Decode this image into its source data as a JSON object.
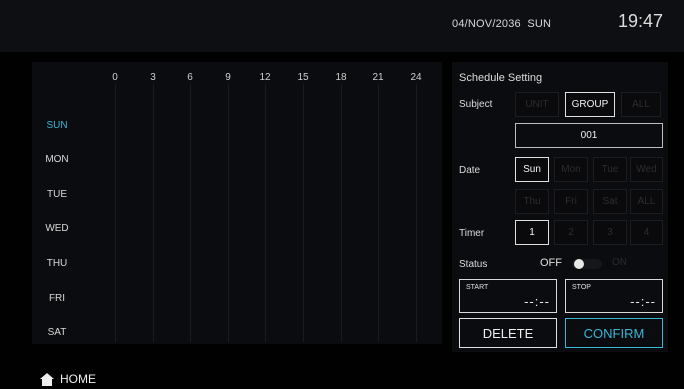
{
  "header": {
    "date": "04/NOV/2036",
    "day": "SUN",
    "time": "19:47"
  },
  "schedule_grid": {
    "hours": [
      "0",
      "3",
      "6",
      "9",
      "12",
      "15",
      "18",
      "21",
      "24"
    ],
    "days": [
      "SUN",
      "MON",
      "TUE",
      "WED",
      "THU",
      "FRI",
      "SAT"
    ],
    "active_day": "SUN"
  },
  "settings": {
    "title": "Schedule Setting",
    "subject_label": "Subject",
    "subject_options": [
      "UNIT",
      "GROUP",
      "ALL"
    ],
    "subject_selected": "GROUP",
    "subject_id": "001",
    "date_label": "Date",
    "date_row1": [
      "Sun",
      "Mon",
      "Tue",
      "Wed"
    ],
    "date_row2": [
      "Thu",
      "Fri",
      "Sat",
      "ALL"
    ],
    "date_selected": "Sun",
    "timer_label": "Timer",
    "timer_options": [
      "1",
      "2",
      "3",
      "4"
    ],
    "timer_selected": "1",
    "status_label": "Status",
    "status_off": "OFF",
    "status_on": "ON",
    "start_label": "START",
    "start_value": "--:--",
    "stop_label": "STOP",
    "stop_value": "--:--",
    "delete_label": "DELETE",
    "confirm_label": "CONFIRM"
  },
  "footer": {
    "home_label": "HOME",
    "home_icon": "home-icon"
  },
  "colors": {
    "accent": "#39b6d6",
    "background": "#010101",
    "panel": "#0b0c0f"
  }
}
